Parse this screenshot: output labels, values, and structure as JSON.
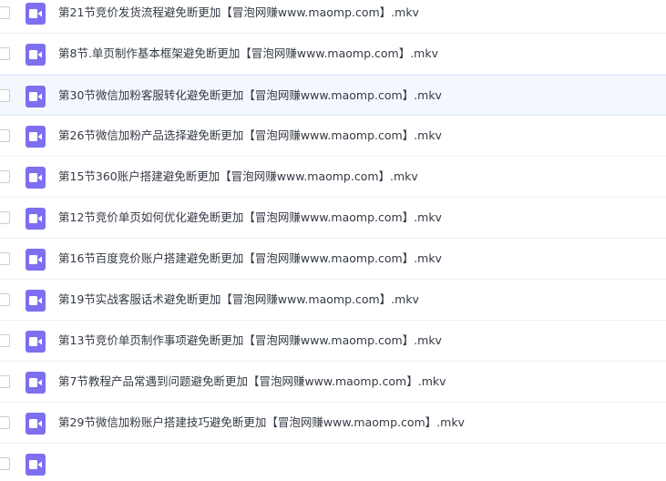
{
  "file_list": {
    "icon": "video-file-icon",
    "accent_color": "#7d6ff0",
    "items": [
      {
        "name": "第21节竞价发货流程避免断更加【冒泡网赚www.maomp.com】.mkv"
      },
      {
        "name": "第8节.单页制作基本框架避免断更加【冒泡网赚www.maomp.com】.mkv"
      },
      {
        "name": "第30节微信加粉客服转化避免断更加【冒泡网赚www.maomp.com】.mkv"
      },
      {
        "name": "第26节微信加粉产品选择避免断更加【冒泡网赚www.maomp.com】.mkv"
      },
      {
        "name": "第15节360账户搭建避免断更加【冒泡网赚www.maomp.com】.mkv"
      },
      {
        "name": "第12节竞价单页如何优化避免断更加【冒泡网赚www.maomp.com】.mkv"
      },
      {
        "name": "第16节百度竞价账户搭建避免断更加【冒泡网赚www.maomp.com】.mkv"
      },
      {
        "name": "第19节实战客服话术避免断更加【冒泡网赚www.maomp.com】.mkv"
      },
      {
        "name": "第13节竞价单页制作事项避免断更加【冒泡网赚www.maomp.com】.mkv"
      },
      {
        "name": "第7节教程产品常遇到问题避免断更加【冒泡网赚www.maomp.com】.mkv"
      },
      {
        "name": "第29节微信加粉账户搭建技巧避免断更加【冒泡网赚www.maomp.com】.mkv"
      }
    ]
  }
}
